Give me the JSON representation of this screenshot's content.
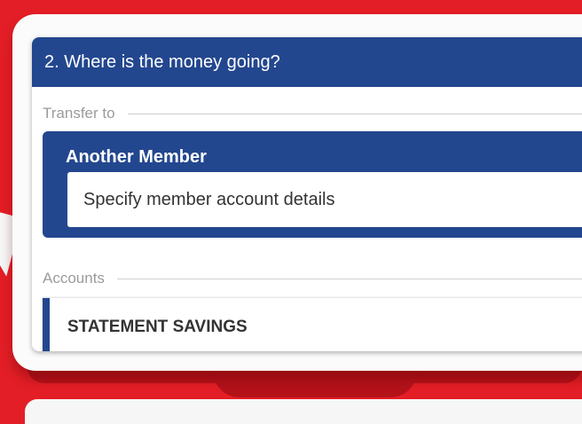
{
  "colors": {
    "background": "#e41e26",
    "accent": "#23478f",
    "panel": "#ffffff"
  },
  "step": {
    "title": "2. Where is the money going?"
  },
  "transfer_to": {
    "label": "Transfer to",
    "option": {
      "title": "Another Member",
      "input_value": "Specify member account details"
    }
  },
  "accounts": {
    "label": "Accounts",
    "items": [
      {
        "name": "STATEMENT SAVINGS"
      }
    ]
  }
}
